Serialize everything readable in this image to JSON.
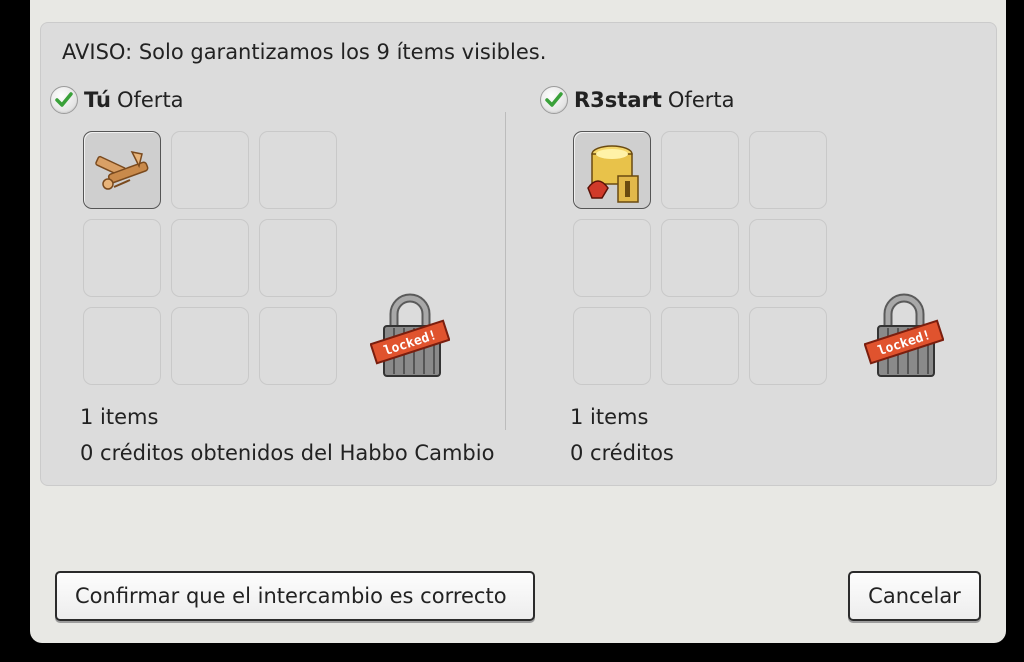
{
  "notice": "AVISO: Solo garantizamos los 9 ítems visibles.",
  "my_offer": {
    "owner": "Tú",
    "label": "Oferta",
    "item_count": "1 items",
    "credits": "0 créditos obtenidos del Habbo Cambio"
  },
  "their_offer": {
    "owner": "R3start",
    "label": "Oferta",
    "item_count": "1 items",
    "credits": "0 créditos"
  },
  "lock_label": "locked!",
  "buttons": {
    "confirm": "Confirmar que el intercambio es correcto",
    "cancel": "Cancelar"
  },
  "colors": {
    "check_green": "#3aa13a",
    "lock_ribbon": "#e0532e"
  }
}
